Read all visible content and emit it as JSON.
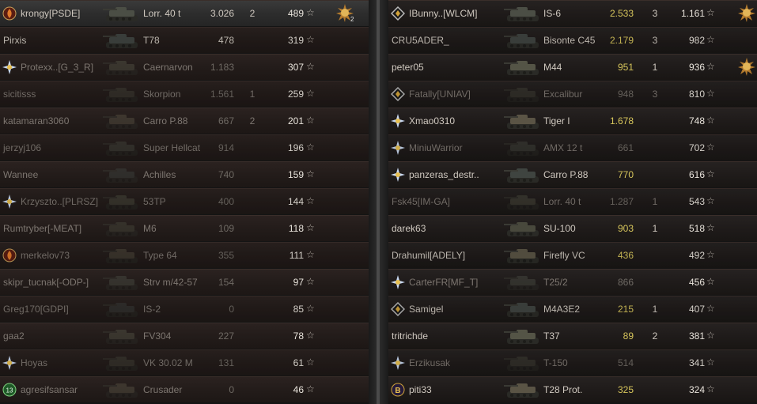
{
  "team_left": [
    {
      "name": "krongy[PSDE]",
      "tank": "Lorr. 40 t",
      "frags": "3.026",
      "kills": "2",
      "xp": "489",
      "badge": "flame",
      "state": "self",
      "medal": "2"
    },
    {
      "name": "Pirxis",
      "tank": "T78",
      "frags": "478",
      "kills": "",
      "xp": "319",
      "badge": "",
      "state": "normal"
    },
    {
      "name": "Protexx..[G_3_R]",
      "tank": "Caernarvon",
      "frags": "1.183",
      "kills": "",
      "xp": "307",
      "badge": "star",
      "state": "dead"
    },
    {
      "name": "sicitisss",
      "tank": "Skorpion",
      "frags": "1.561",
      "kills": "1",
      "xp": "259",
      "badge": "",
      "state": "dead"
    },
    {
      "name": "katamaran3060",
      "tank": "Carro P.88",
      "frags": "667",
      "kills": "2",
      "xp": "201",
      "badge": "",
      "state": "dead"
    },
    {
      "name": "jerzyj106",
      "tank": "Super Hellcat",
      "frags": "914",
      "kills": "",
      "xp": "196",
      "badge": "",
      "state": "dead"
    },
    {
      "name": "Wannee",
      "tank": "Achilles",
      "frags": "740",
      "kills": "",
      "xp": "159",
      "badge": "",
      "state": "dead"
    },
    {
      "name": "Krzyszto..[PLRSZ]",
      "tank": "53TP",
      "frags": "400",
      "kills": "",
      "xp": "144",
      "badge": "star",
      "state": "dead"
    },
    {
      "name": "Rumtryber[-MEAT]",
      "tank": "M6",
      "frags": "109",
      "kills": "",
      "xp": "118",
      "badge": "",
      "state": "dead"
    },
    {
      "name": "merkelov73",
      "tank": "Type 64",
      "frags": "355",
      "kills": "",
      "xp": "111",
      "badge": "fire",
      "state": "dead"
    },
    {
      "name": "skipr_tucnak[-ODP-]",
      "tank": "Strv m/42-57",
      "frags": "154",
      "kills": "",
      "xp": "97",
      "badge": "",
      "state": "dead"
    },
    {
      "name": "Greg170[GDPI]",
      "tank": "IS-2",
      "frags": "0",
      "kills": "",
      "xp": "85",
      "badge": "",
      "state": "dead"
    },
    {
      "name": "gaa2",
      "tank": "FV304",
      "frags": "227",
      "kills": "",
      "xp": "78",
      "badge": "",
      "state": "dead"
    },
    {
      "name": "Hoyas",
      "tank": "VK 30.02 M",
      "frags": "131",
      "kills": "",
      "xp": "61",
      "badge": "star",
      "state": "dead"
    },
    {
      "name": "agresifsansar",
      "tank": "Crusader",
      "frags": "0",
      "kills": "",
      "xp": "46",
      "badge": "13",
      "state": "dead"
    }
  ],
  "team_right": [
    {
      "name": "IBunny..[WLCM]",
      "tank": "IS-6",
      "frags": "2.533",
      "kills": "3",
      "xp": "1.161",
      "badge": "diamond",
      "state": "highlight",
      "medal": ""
    },
    {
      "name": "CRU5ADER_",
      "tank": "Bisonte C45",
      "frags": "2.179",
      "kills": "3",
      "xp": "982",
      "badge": "",
      "state": "highlight"
    },
    {
      "name": "peter05",
      "tank": "M44",
      "frags": "951",
      "kills": "1",
      "xp": "936",
      "badge": "",
      "state": "highlight",
      "medal": ""
    },
    {
      "name": "Fatally[UNIAV]",
      "tank": "Excalibur",
      "frags": "948",
      "kills": "3",
      "xp": "810",
      "badge": "diamond2",
      "state": "dead"
    },
    {
      "name": "Xmao0310",
      "tank": "Tiger I",
      "frags": "1.678",
      "kills": "",
      "xp": "748",
      "badge": "star",
      "state": "highlight"
    },
    {
      "name": "MiniuWarrior",
      "tank": "AMX 12 t",
      "frags": "661",
      "kills": "",
      "xp": "702",
      "badge": "star",
      "state": "dead"
    },
    {
      "name": "panzeras_destr..",
      "tank": "Carro P.88",
      "frags": "770",
      "kills": "",
      "xp": "616",
      "badge": "star",
      "state": "highlight"
    },
    {
      "name": "Fsk45[IM-GA]",
      "tank": "Lorr. 40 t",
      "frags": "1.287",
      "kills": "1",
      "xp": "543",
      "badge": "",
      "state": "dead"
    },
    {
      "name": "darek63",
      "tank": "SU-100",
      "frags": "903",
      "kills": "1",
      "xp": "518",
      "badge": "",
      "state": "highlight"
    },
    {
      "name": "Drahumil[ADELY]",
      "tank": "Firefly VC",
      "frags": "436",
      "kills": "",
      "xp": "492",
      "badge": "",
      "state": "highlight"
    },
    {
      "name": "CarterFR[MF_T]",
      "tank": "T25/2",
      "frags": "866",
      "kills": "",
      "xp": "456",
      "badge": "star",
      "state": "dead"
    },
    {
      "name": "Samigel",
      "tank": "M4A3E2",
      "frags": "215",
      "kills": "1",
      "xp": "407",
      "badge": "diamond",
      "state": "highlight"
    },
    {
      "name": "tritrichde",
      "tank": "T37",
      "frags": "89",
      "kills": "2",
      "xp": "381",
      "badge": "",
      "state": "highlight"
    },
    {
      "name": "Erzikusak",
      "tank": "T-150",
      "frags": "514",
      "kills": "",
      "xp": "341",
      "badge": "star",
      "state": "dead"
    },
    {
      "name": "piti33",
      "tank": "T28 Prot.",
      "frags": "325",
      "kills": "",
      "xp": "324",
      "badge": "B",
      "state": "highlight"
    }
  ],
  "icons": {
    "xp": "star-outline-icon",
    "medal": "sun-medal-icon"
  },
  "colors": {
    "highlight_frags": "#d5c45b",
    "text": "#cfc8bf",
    "dead_text": "#7d7670"
  }
}
